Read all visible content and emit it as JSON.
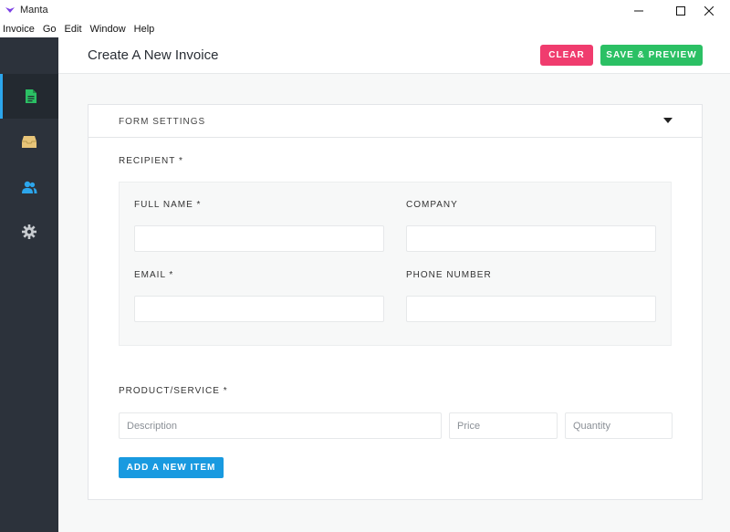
{
  "window": {
    "title": "Manta",
    "accent": "#7b3fe4"
  },
  "menu": [
    "Invoice",
    "Go",
    "Edit",
    "Window",
    "Help"
  ],
  "sidebar": {
    "items": [
      {
        "icon": "document-icon",
        "active": true,
        "color": "#2bc064"
      },
      {
        "icon": "inbox-icon",
        "active": false,
        "color": "#e8c579"
      },
      {
        "icon": "contacts-icon",
        "active": false,
        "color": "#2ca6ec"
      },
      {
        "icon": "gear-icon",
        "active": false,
        "color": "#c8ccd0"
      }
    ]
  },
  "header": {
    "title": "Create A New Invoice",
    "clear_label": "CLEAR",
    "save_label": "SAVE & PREVIEW"
  },
  "form": {
    "settings_label": "FORM SETTINGS",
    "recipient": {
      "label": "RECIPIENT *",
      "full_name_label": "FULL NAME *",
      "full_name_value": "",
      "company_label": "COMPANY",
      "company_value": "",
      "email_label": "EMAIL *",
      "email_value": "",
      "phone_label": "PHONE NUMBER",
      "phone_value": ""
    },
    "product": {
      "label": "PRODUCT/SERVICE *",
      "description_placeholder": "Description",
      "price_placeholder": "Price",
      "quantity_placeholder": "Quantity",
      "add_item_label": "ADD A NEW ITEM"
    }
  },
  "colors": {
    "sidebar_bg": "#2c323b",
    "clear_button": "#f03c6e",
    "save_button": "#2bc064",
    "add_button": "#199ae0",
    "active_indicator": "#2ca6ec"
  }
}
